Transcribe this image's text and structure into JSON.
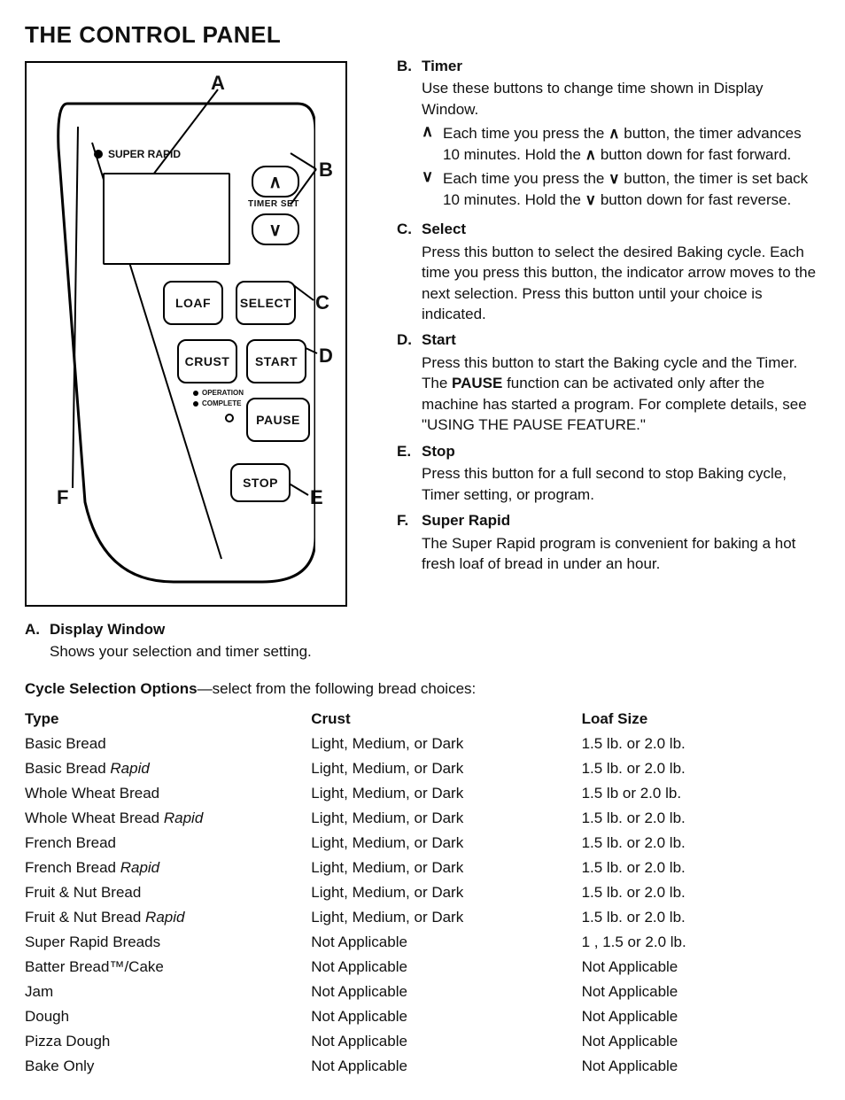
{
  "title": "THE CONTROL PANEL",
  "diagram": {
    "super_rapid_label": "SUPER RAPID",
    "timer_set_label": "TIMER SET",
    "buttons": {
      "up": "∧",
      "down": "∨",
      "loaf": "LOAF",
      "select": "SELECT",
      "crust": "CRUST",
      "start": "START",
      "pause": "PAUSE",
      "stop": "STOP"
    },
    "indicators": {
      "operation": "OPERATION",
      "complete": "COMPLETE"
    },
    "callouts": {
      "A": "A",
      "B": "B",
      "C": "C",
      "D": "D",
      "E": "E",
      "F": "F"
    }
  },
  "descriptions": {
    "A": {
      "title": "Display Window",
      "text": "Shows your selection and timer setting."
    },
    "B": {
      "title": "Timer",
      "intro": "Use these buttons to change time shown in Display Window.",
      "up_glyph": "∧",
      "up_text_1": "Each time you press the ",
      "up_text_2": " button, the timer advances 10 minutes. Hold the ",
      "up_text_3": " button down for fast forward.",
      "down_glyph": "∨",
      "down_text_1": "Each time you press the ",
      "down_text_2": " button, the timer is set back 10 minutes. Hold the ",
      "down_text_3": " button down for fast reverse."
    },
    "C": {
      "title": "Select",
      "text": "Press this button to select the desired Baking cycle. Each time you press this button, the indicator arrow moves to the next selection. Press this button until your choice is indicated."
    },
    "D": {
      "title": "Start",
      "text_1": "Press this button to start the Baking cycle and the Timer. The ",
      "pause_word": "PAUSE",
      "text_2": " function can be activated only after the machine has started a program. For complete details, see \"USING THE PAUSE FEATURE.\""
    },
    "E": {
      "title": "Stop",
      "text": "Press this button for a full second to stop Baking cycle, Timer setting, or program."
    },
    "F": {
      "title": "Super Rapid",
      "text": "The Super Rapid program is convenient for baking a hot fresh loaf of bread in under an hour."
    }
  },
  "cycle_options": {
    "heading_bold": "Cycle Selection Options",
    "heading_rest": "—select from the following bread choices:",
    "cols": {
      "type": "Type",
      "crust": "Crust",
      "loaf": "Loaf Size"
    },
    "rows": [
      {
        "type": "Basic Bread",
        "rapid": false,
        "crust": "Light, Medium, or Dark",
        "loaf": "1.5 lb. or 2.0 lb."
      },
      {
        "type": "Basic Bread",
        "rapid": true,
        "crust": "Light, Medium, or Dark",
        "loaf": "1.5 lb. or 2.0 lb."
      },
      {
        "type": "Whole Wheat Bread",
        "rapid": false,
        "crust": "Light, Medium, or Dark",
        "loaf": "1.5 lb  or 2.0 lb."
      },
      {
        "type": "Whole Wheat Bread",
        "rapid": true,
        "crust": "Light, Medium, or Dark",
        "loaf": "1.5 lb. or 2.0 lb."
      },
      {
        "type": "French Bread",
        "rapid": false,
        "crust": "Light, Medium, or Dark",
        "loaf": "1.5 lb. or 2.0 lb."
      },
      {
        "type": "French Bread",
        "rapid": true,
        "crust": "Light, Medium, or Dark",
        "loaf": "1.5 lb. or 2.0 lb."
      },
      {
        "type": "Fruit & Nut Bread",
        "rapid": false,
        "crust": "Light, Medium, or Dark",
        "loaf": "1.5 lb. or 2.0 lb."
      },
      {
        "type": "Fruit & Nut Bread",
        "rapid": true,
        "crust": "Light, Medium, or Dark",
        "loaf": "1.5 lb. or 2.0 lb."
      },
      {
        "type": "Super Rapid Breads",
        "rapid": false,
        "crust": "Not Applicable",
        "loaf": "1 , 1.5 or 2.0 lb."
      },
      {
        "type": "Batter Bread™/Cake",
        "rapid": false,
        "crust": "Not Applicable",
        "loaf": "Not Applicable"
      },
      {
        "type": "Jam",
        "rapid": false,
        "crust": "Not Applicable",
        "loaf": "Not Applicable"
      },
      {
        "type": "Dough",
        "rapid": false,
        "crust": "Not Applicable",
        "loaf": "Not Applicable"
      },
      {
        "type": "Pizza Dough",
        "rapid": false,
        "crust": "Not Applicable",
        "loaf": "Not Applicable"
      },
      {
        "type": "Bake Only",
        "rapid": false,
        "crust": "Not Applicable",
        "loaf": "Not Applicable"
      }
    ],
    "rapid_word": "Rapid"
  }
}
